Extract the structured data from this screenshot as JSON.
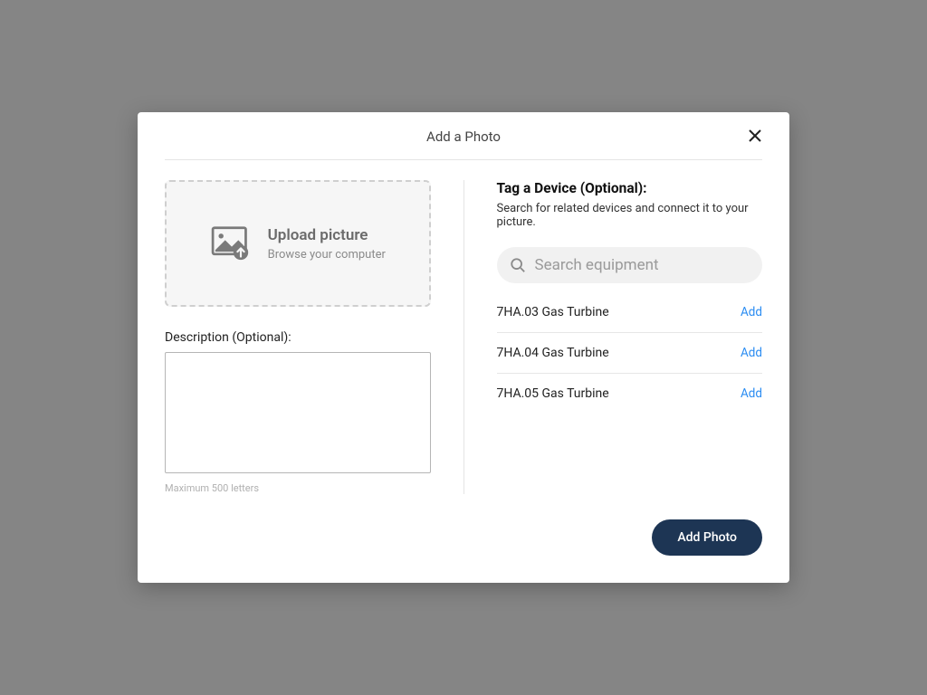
{
  "modal": {
    "title": "Add a Photo"
  },
  "upload": {
    "heading": "Upload picture",
    "sub": "Browse your computer"
  },
  "description": {
    "label": "Description (Optional):",
    "value": "",
    "helper": "Maximum 500 letters"
  },
  "tag": {
    "title": "Tag a Device (Optional):",
    "sub": "Search for related devices and connect it to your picture.",
    "search_placeholder": "Search equipment",
    "equipment": [
      {
        "name": "7HA.03 Gas Turbine",
        "action": "Add"
      },
      {
        "name": "7HA.04 Gas Turbine",
        "action": "Add"
      },
      {
        "name": "7HA.05 Gas Turbine",
        "action": "Add"
      }
    ]
  },
  "footer": {
    "submit": "Add Photo"
  }
}
